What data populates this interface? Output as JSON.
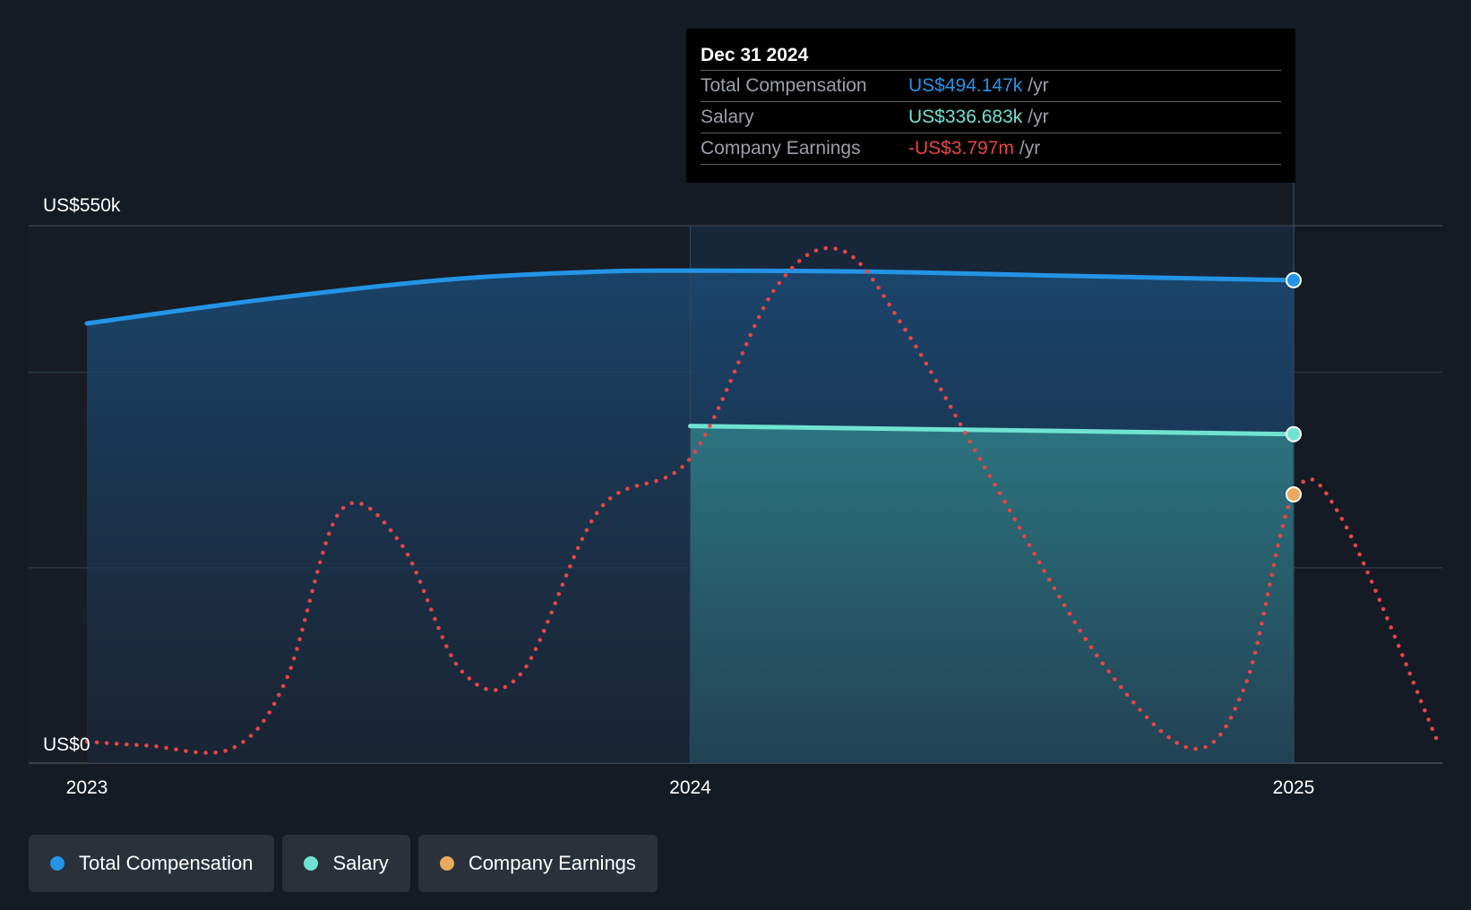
{
  "tooltip": {
    "date": "Dec 31 2024",
    "rows": [
      {
        "label": "Total Compensation",
        "value": "US$494.147k",
        "unit": "/yr",
        "color": "#2394e6"
      },
      {
        "label": "Salary",
        "value": "US$336.683k",
        "unit": "/yr",
        "color": "#6fe3d1"
      },
      {
        "label": "Company Earnings",
        "value": "-US$3.797m",
        "unit": "/yr",
        "color": "#e84545"
      }
    ]
  },
  "legend": [
    {
      "label": "Total Compensation",
      "color": "#2394e6"
    },
    {
      "label": "Salary",
      "color": "#6fe3d1"
    },
    {
      "label": "Company Earnings",
      "color": "#e8a95c"
    }
  ],
  "chart_data": {
    "type": "area",
    "y_tick_labels": [
      "US$550k",
      "US$0"
    ],
    "ylim": [
      0,
      550
    ],
    "x_tick_labels": [
      "2023",
      "2024",
      "2025"
    ],
    "xlim": [
      2023,
      2025.24
    ],
    "series": [
      {
        "name": "Total Compensation",
        "color": "#2394e6",
        "points": [
          [
            2023.0,
            450
          ],
          [
            2023.3,
            475
          ],
          [
            2023.6,
            495
          ],
          [
            2023.85,
            503
          ],
          [
            2024.0,
            504
          ],
          [
            2024.3,
            503
          ],
          [
            2024.6,
            499
          ],
          [
            2025.0,
            494.147
          ]
        ]
      },
      {
        "name": "Salary",
        "color": "#6fe3d1",
        "points": [
          [
            2024.0,
            345
          ],
          [
            2025.0,
            336.683
          ]
        ]
      },
      {
        "name": "Company Earnings",
        "color": "#e84545",
        "marker_color": "#e8a95c",
        "points": [
          [
            2023.0,
            22
          ],
          [
            2023.1,
            18
          ],
          [
            2023.24,
            15
          ],
          [
            2023.33,
            85
          ],
          [
            2023.42,
            258
          ],
          [
            2023.52,
            225
          ],
          [
            2023.62,
            95
          ],
          [
            2023.72,
            92
          ],
          [
            2023.85,
            260
          ],
          [
            2024.0,
            312
          ],
          [
            2024.14,
            485
          ],
          [
            2024.25,
            525
          ],
          [
            2024.36,
            440
          ],
          [
            2024.5,
            290
          ],
          [
            2024.68,
            105
          ],
          [
            2024.83,
            15
          ],
          [
            2024.92,
            80
          ],
          [
            2025.0,
            275
          ],
          [
            2025.08,
            250
          ],
          [
            2025.24,
            20
          ]
        ]
      }
    ]
  }
}
